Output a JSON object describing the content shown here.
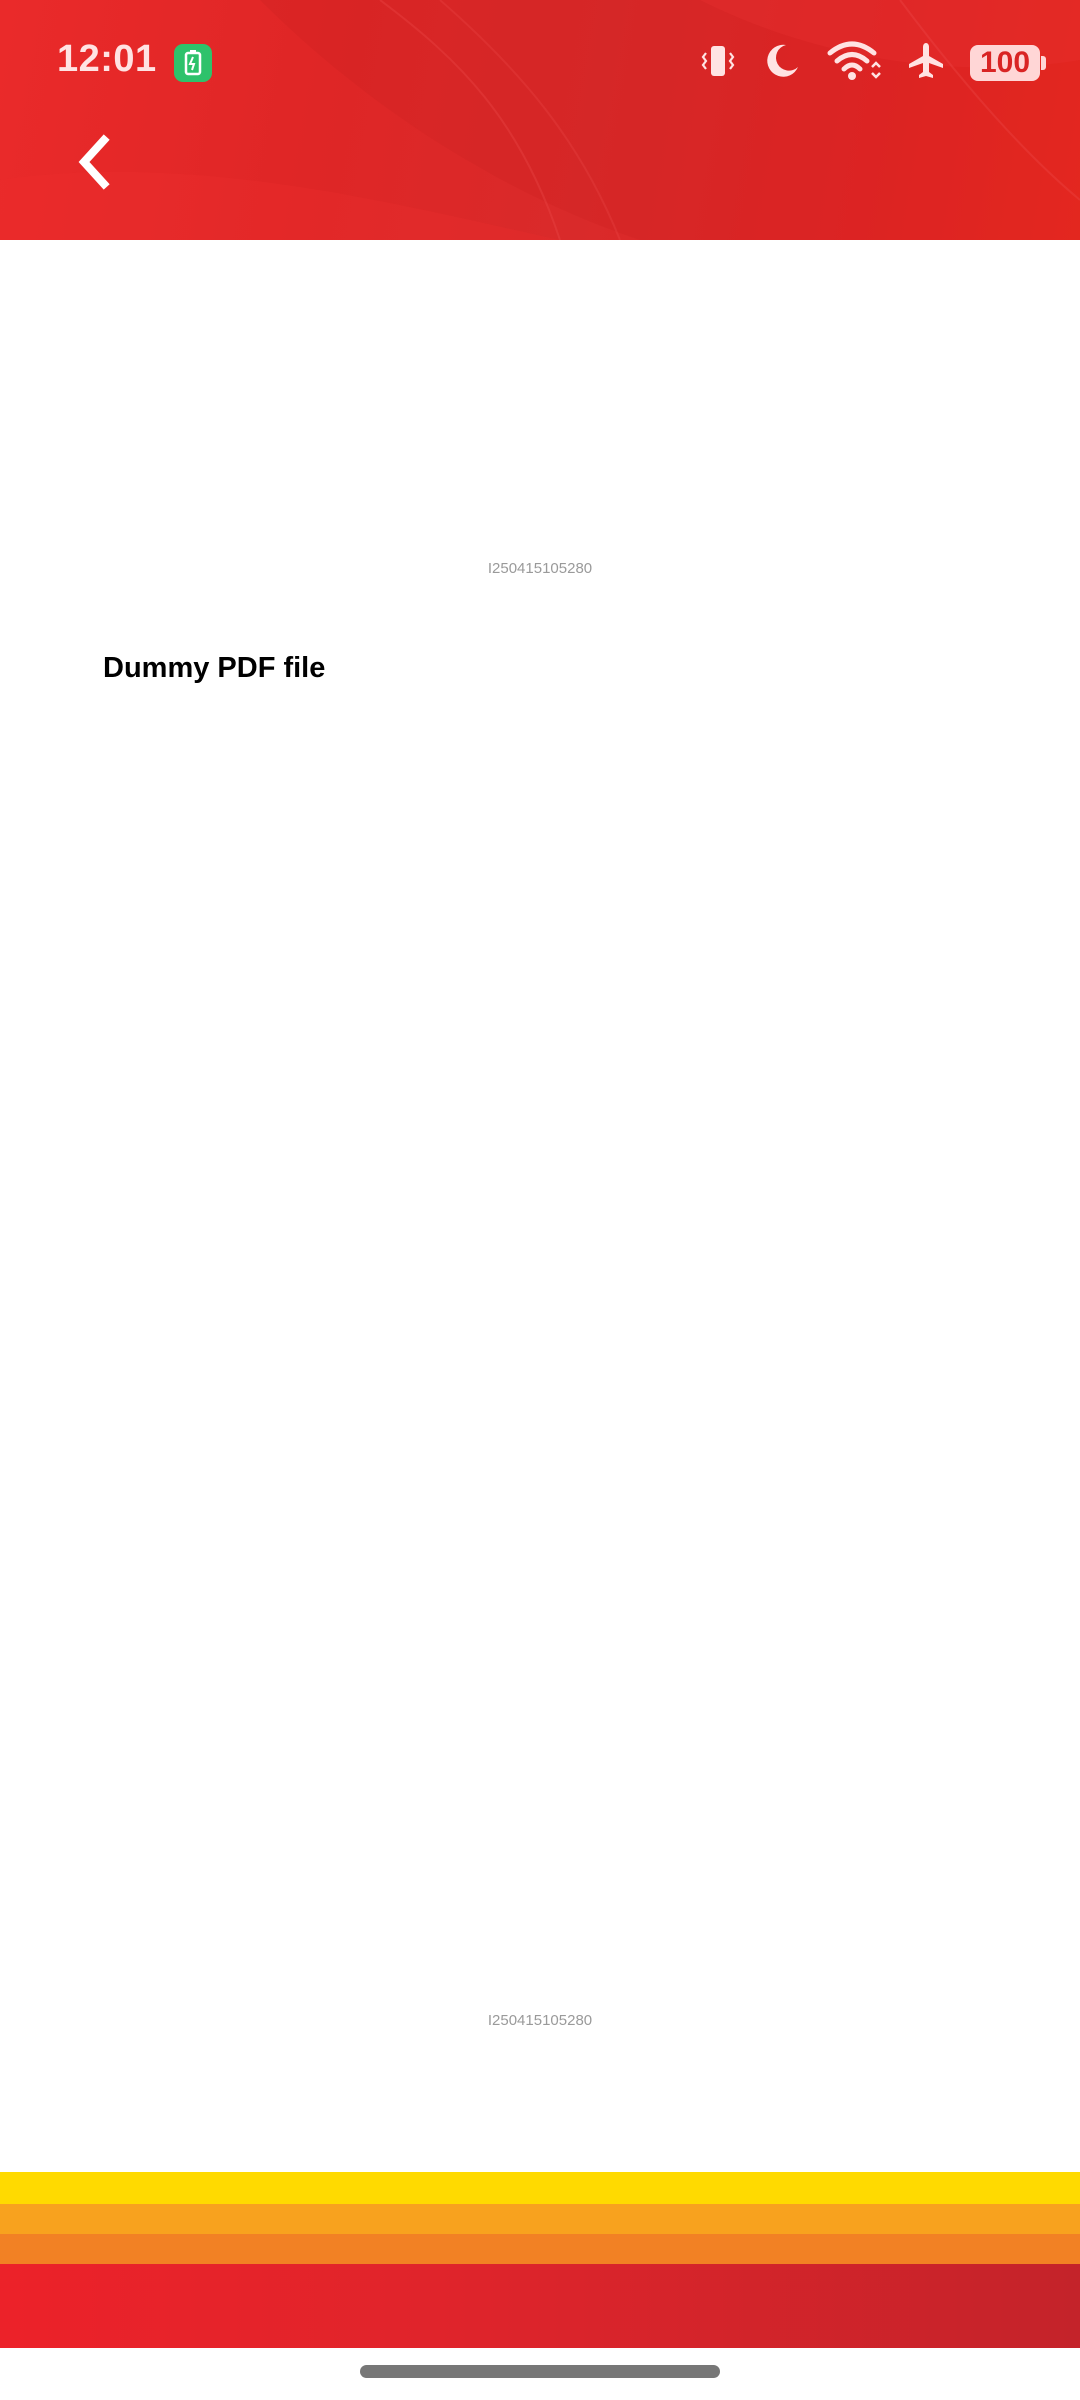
{
  "status_bar": {
    "time": "12:01",
    "battery_level": "100",
    "icons": [
      "battery-saver-icon",
      "vibrate-icon",
      "do-not-disturb-icon",
      "wifi-icon",
      "airplane-mode-icon",
      "battery-icon"
    ]
  },
  "header": {
    "back_icon": "chevron-left-icon",
    "colors": {
      "primary": "#df2626",
      "status_text": "#ffe3e3"
    }
  },
  "document": {
    "id_top": "I250415105280",
    "title": "Dummy PDF file",
    "id_bottom": "I250415105280"
  },
  "footer": {
    "stripe_colors": [
      "#ffda00",
      "#f8a21e",
      "#f28124",
      "#e0242b"
    ]
  }
}
